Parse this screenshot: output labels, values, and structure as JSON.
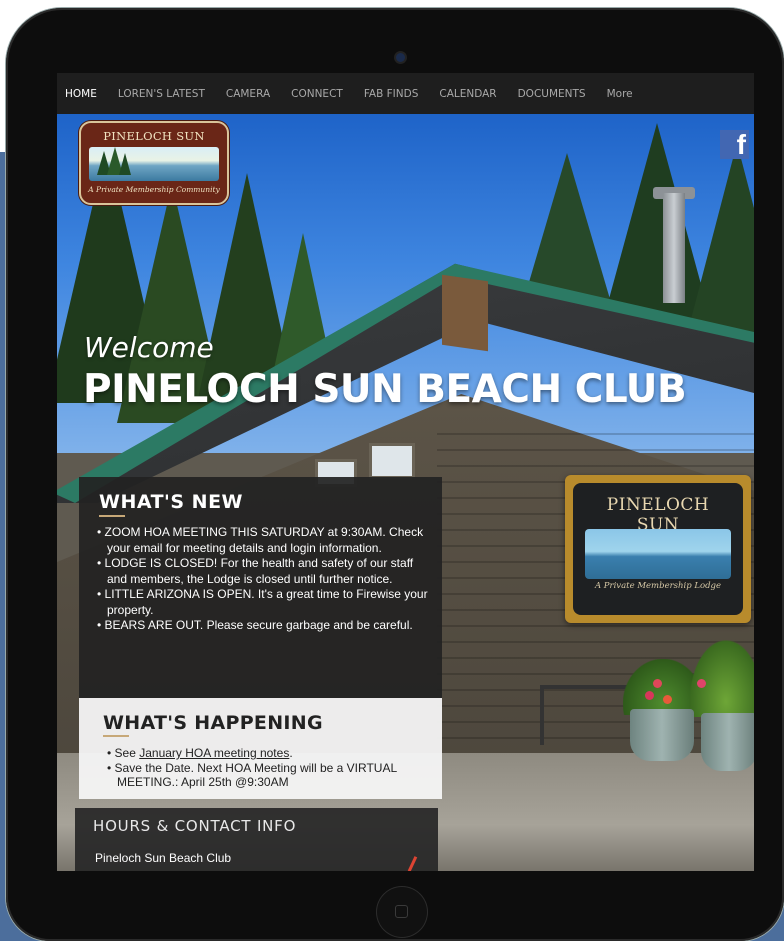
{
  "nav": {
    "items": [
      "HOME",
      "LOREN'S LATEST",
      "CAMERA",
      "CONNECT",
      "FAB FINDS",
      "CALENDAR",
      "DOCUMENTS",
      "More"
    ],
    "active": "HOME"
  },
  "logo": {
    "title": "PINELOCH SUN",
    "subtitle": "A Private Membership Community"
  },
  "social": {
    "facebook_glyph": "f"
  },
  "hero": {
    "welcome": "Welcome",
    "title": "PINELOCH SUN BEACH CLUB"
  },
  "sign": {
    "title": "PINELOCH SUN",
    "subtitle": "A Private Membership Lodge"
  },
  "whats_new": {
    "heading": "WHAT'S NEW",
    "items": [
      "ZOOM HOA MEETING THIS SATURDAY at 9:30AM. Check your email for meeting details and login information.",
      "LODGE IS CLOSED! For the health and safety of our staff and members, the Lodge is closed until further notice.",
      "LITTLE ARIZONA IS OPEN. It's a great time to Firewise your property.",
      "BEARS ARE OUT. Please secure garbage and be careful."
    ]
  },
  "whats_happening": {
    "heading": "WHAT'S HAPPENING",
    "item1_prefix": "See ",
    "item1_link": "January HOA meeting notes",
    "item1_suffix": ".",
    "item2": "Save the Date. Next HOA Meeting will be a VIRTUAL MEETING.: April 25th @9:30AM"
  },
  "hours": {
    "heading": "HOURS & CONTACT INFO",
    "line1": "Pineloch Sun Beach Club"
  },
  "colors": {
    "nav_bg": "#1e1e1e",
    "accent_rule": "#c7a878",
    "facebook": "#4267b2",
    "logo_bg": "#6a2617"
  },
  "icons": {
    "facebook": "facebook-icon",
    "home_button": "home-button-icon",
    "camera": "front-camera-icon"
  }
}
